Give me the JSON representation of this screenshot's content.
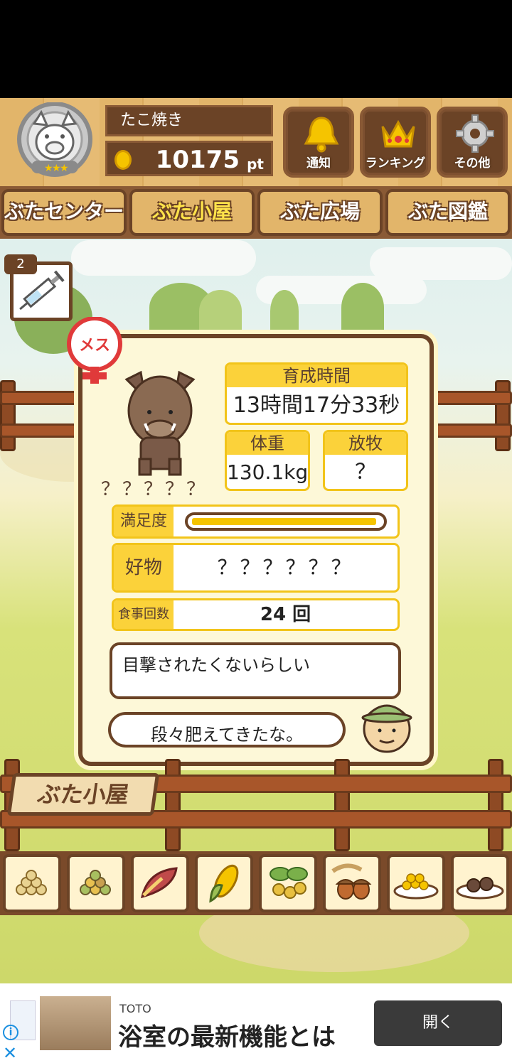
{
  "header": {
    "player_name": "たこ焼き",
    "points": "10175",
    "points_unit": "pt",
    "buttons": [
      {
        "label": "通知",
        "icon": "bell-icon"
      },
      {
        "label": "ランキング",
        "icon": "crown-icon"
      },
      {
        "label": "その他",
        "icon": "gear-icon"
      }
    ]
  },
  "tabs": [
    {
      "label": "ぶたセンター",
      "active": false
    },
    {
      "label": "ぶた小屋",
      "active": true
    },
    {
      "label": "ぶた広場",
      "active": false
    },
    {
      "label": "ぶた図鑑",
      "active": false
    }
  ],
  "syringe": {
    "count": "2",
    "icon": "syringe-icon"
  },
  "pig": {
    "gender_badge": "メス",
    "name": "？？？？？",
    "raising_time_label": "育成時間",
    "raising_time_value": "13時間17分33秒",
    "weight_label": "体重",
    "weight_value": "130.1kg",
    "grazing_label": "放牧",
    "grazing_value": "？",
    "satisfaction_label": "満足度",
    "satisfaction_level": 0.98,
    "favorite_label": "好物",
    "favorite_value": "？？？？？？",
    "meals_label": "食事回数",
    "meals_value": "24 回",
    "pig_speech": "目撃されたくないらしい",
    "farmer_speech": "段々肥えてきたな。"
  },
  "sign_label": "ぶた小屋",
  "foods": [
    {
      "icon": "soybeans-icon"
    },
    {
      "icon": "mixed-beans-icon"
    },
    {
      "icon": "sweet-potato-icon"
    },
    {
      "icon": "corn-icon"
    },
    {
      "icon": "berries-icon"
    },
    {
      "icon": "acorns-icon"
    },
    {
      "icon": "grain-bowl-icon"
    },
    {
      "icon": "chocolate-plate-icon"
    }
  ],
  "ad": {
    "brand": "TOTO",
    "title": "浴室の最新機能とは",
    "button_label": "開く"
  },
  "colors": {
    "wood_dark": "#6b4326",
    "wood_light": "#e2b56a",
    "accent_yellow": "#fbd23a",
    "card_bg": "#fdf8d8",
    "female_red": "#e03a3a"
  }
}
